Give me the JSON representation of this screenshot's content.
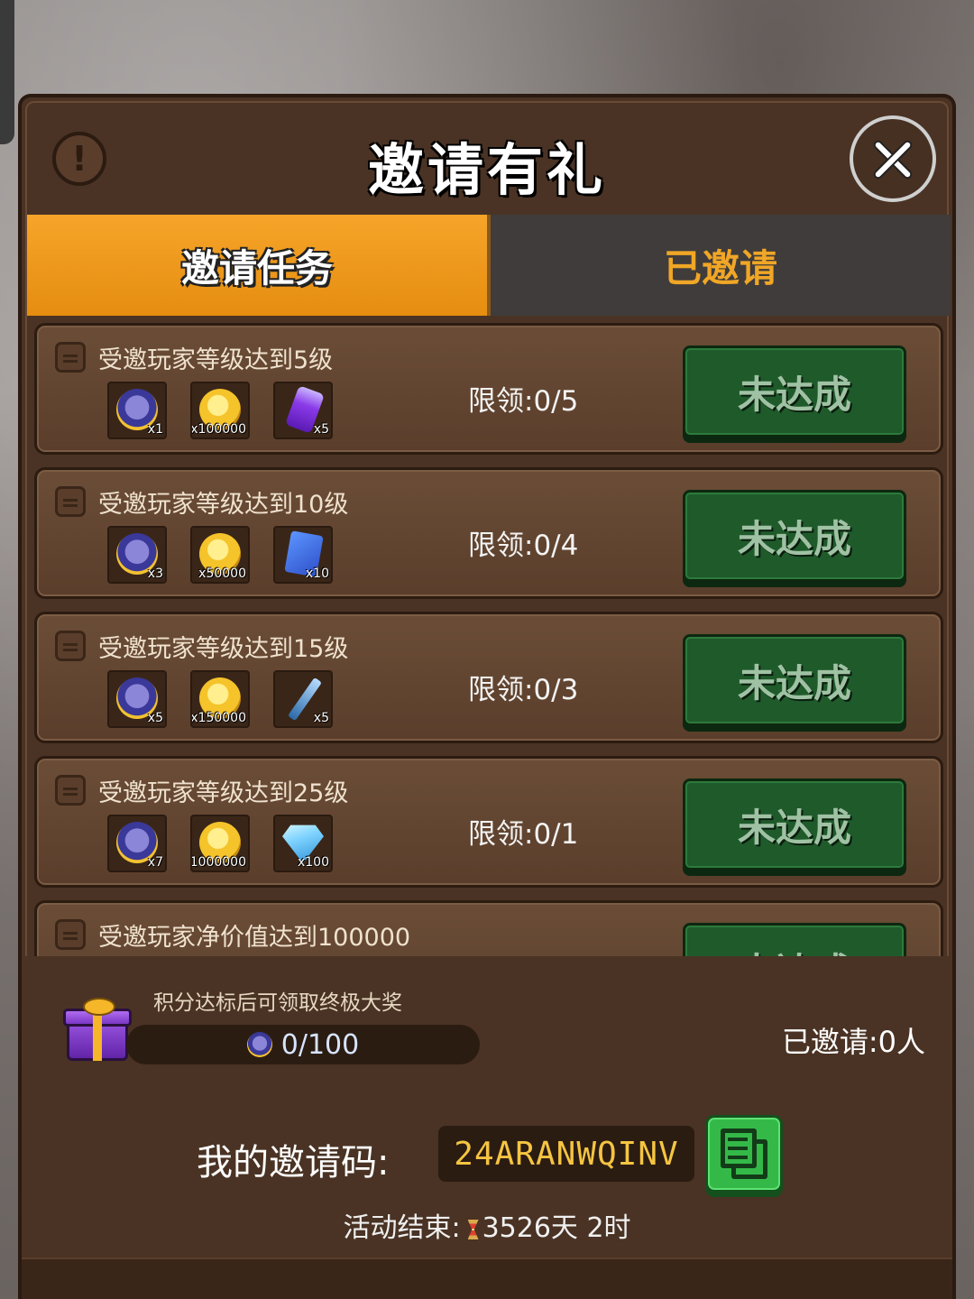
{
  "title": "邀请有礼",
  "tabs": [
    {
      "label": "邀请任务",
      "active": true
    },
    {
      "label": "已邀请",
      "active": false
    }
  ],
  "tasks": [
    {
      "title": "受邀玩家等级达到5级",
      "limit": "限领:0/5",
      "status": "未达成",
      "rewards": [
        {
          "icon": "friend-token-icon",
          "qty": "x1"
        },
        {
          "icon": "gold-coin-icon",
          "qty": "x100000"
        },
        {
          "icon": "energy-can-icon",
          "qty": "x5"
        }
      ]
    },
    {
      "title": "受邀玩家等级达到10级",
      "limit": "限领:0/4",
      "status": "未达成",
      "rewards": [
        {
          "icon": "friend-token-icon",
          "qty": "x3"
        },
        {
          "icon": "gold-coin-icon",
          "qty": "x50000"
        },
        {
          "icon": "blue-book-icon",
          "qty": "x10"
        }
      ]
    },
    {
      "title": "受邀玩家等级达到15级",
      "limit": "限领:0/3",
      "status": "未达成",
      "rewards": [
        {
          "icon": "friend-token-icon",
          "qty": "x5"
        },
        {
          "icon": "gold-coin-icon",
          "qty": "x150000"
        },
        {
          "icon": "syringe-icon",
          "qty": "x5"
        }
      ]
    },
    {
      "title": "受邀玩家等级达到25级",
      "limit": "限领:0/1",
      "status": "未达成",
      "rewards": [
        {
          "icon": "friend-token-icon",
          "qty": "x7"
        },
        {
          "icon": "gold-coin-icon",
          "qty": "x1000000"
        },
        {
          "icon": "diamond-icon",
          "qty": "x100"
        }
      ]
    },
    {
      "title": "受邀玩家净价值达到100000",
      "limit": "",
      "status": "未达成",
      "rewards": []
    }
  ],
  "footer": {
    "score_hint": "积分达标后可领取终极大奖",
    "score_value": "0/100",
    "score_progress": 0,
    "invited_count": "已邀请:0人",
    "code_label": "我的邀请码:",
    "invite_code": "24ARANWQINV",
    "end_label": "活动结束:",
    "end_time": "3526天 2时"
  }
}
